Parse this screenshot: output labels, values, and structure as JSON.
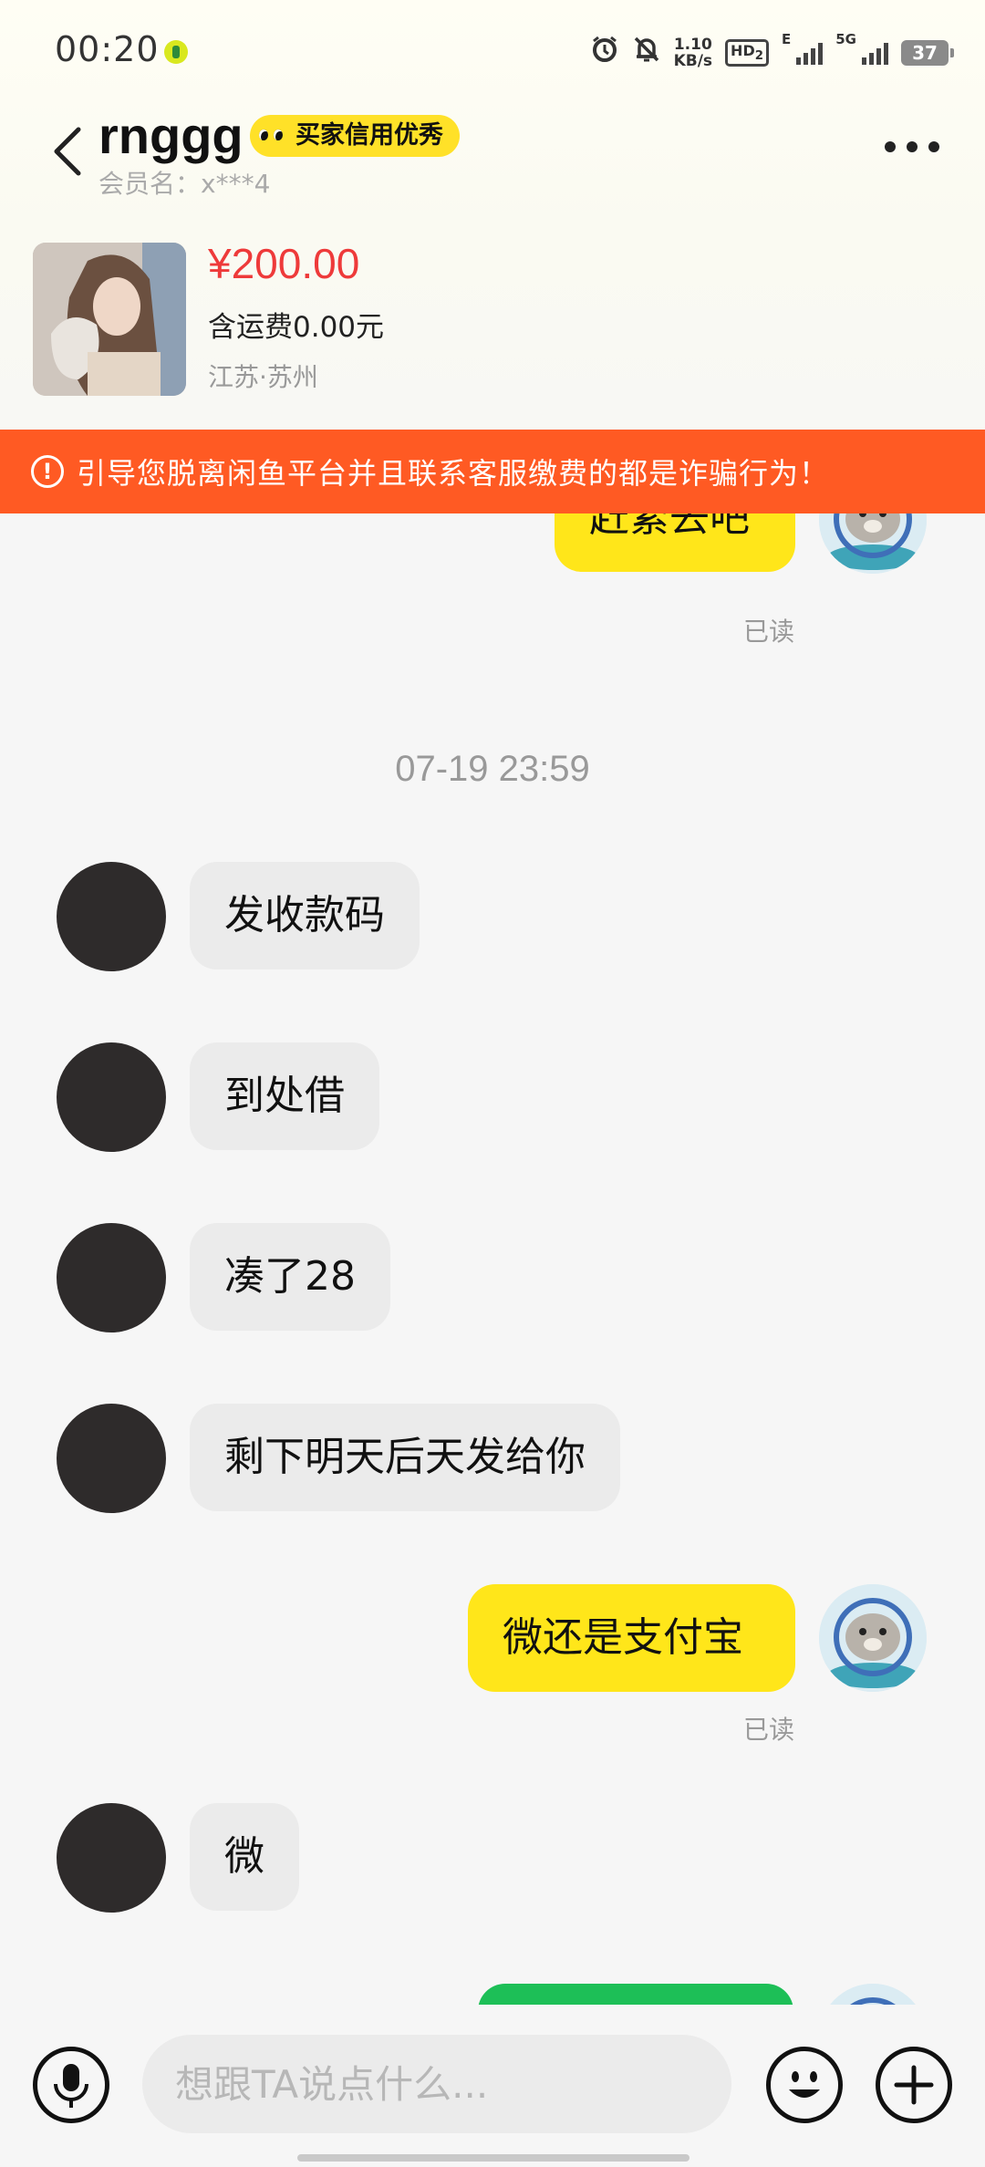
{
  "status_bar": {
    "time": "00:20",
    "net_speed_value": "1.10",
    "net_speed_unit": "KB/s",
    "hd_label": "HD",
    "hd_sub": "2",
    "e_label": "E",
    "network_5g": "5G",
    "battery": "37",
    "icons": [
      "alarm-icon",
      "mute-bell-icon"
    ]
  },
  "header": {
    "nickname": "rnggg",
    "credit_badge": "买家信用优秀",
    "member_name": "会员名：x***4"
  },
  "product": {
    "price": "¥200.00",
    "shipping": "含运费0.00元",
    "location": "江苏·苏州"
  },
  "warning": {
    "icon": "!",
    "text": "引导您脱离闲鱼平台并且联系客服缴费的都是诈骗行为！"
  },
  "chat": {
    "messages": [
      {
        "side": "out",
        "text": "赶紧去吧",
        "status": "已读"
      },
      {
        "timestamp": "07-19 23:59"
      },
      {
        "side": "in",
        "text": "发收款码"
      },
      {
        "side": "in",
        "text": "到处借"
      },
      {
        "side": "in",
        "text": "凑了28"
      },
      {
        "side": "in",
        "text": "剩下明天后天发给你"
      },
      {
        "side": "out",
        "text": "微还是支付宝",
        "status": "已读"
      },
      {
        "side": "in",
        "text": "微"
      }
    ]
  },
  "input": {
    "placeholder": "想跟TA说点什么..."
  },
  "colors": {
    "accent_yellow": "#ffe61a",
    "warning_orange": "#ff5a23",
    "price_red": "#ee3a3a",
    "payment_green": "#1dbf57"
  }
}
